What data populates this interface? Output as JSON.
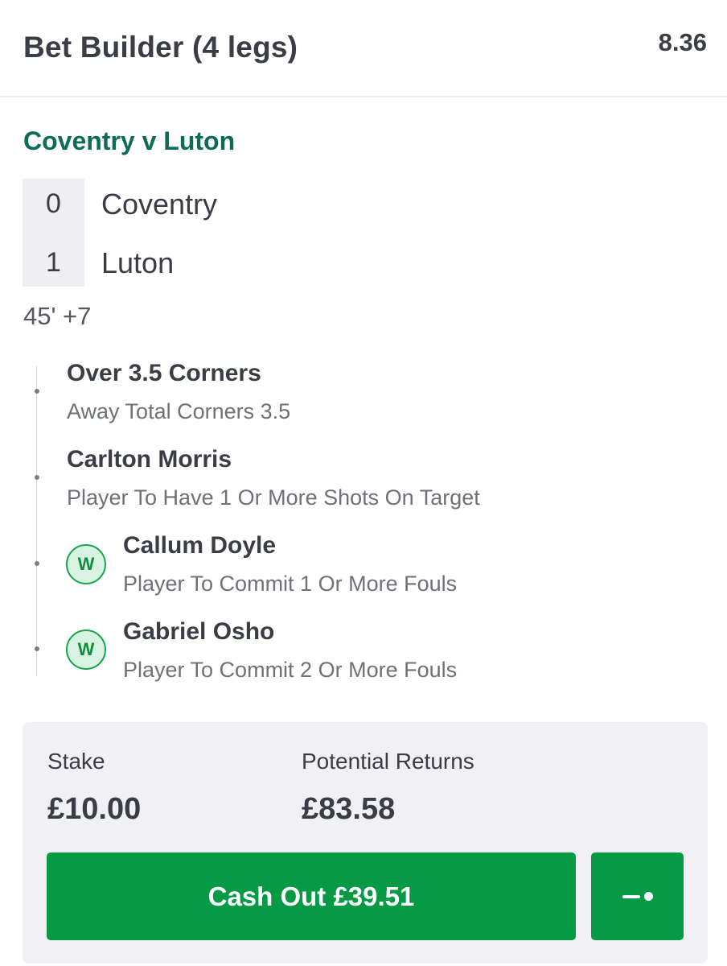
{
  "header": {
    "title": "Bet Builder (4 legs)",
    "odds": "8.36"
  },
  "match": {
    "title": "Coventry v Luton",
    "home_score": "0",
    "home_team": "Coventry",
    "away_score": "1",
    "away_team": "Luton",
    "time": "45' +7"
  },
  "legs": [
    {
      "title": "Over 3.5 Corners",
      "subtitle": "Away Total Corners 3.5",
      "badge": ""
    },
    {
      "title": "Carlton Morris",
      "subtitle": "Player To Have 1 Or More Shots On Target",
      "badge": ""
    },
    {
      "title": "Callum Doyle",
      "subtitle": "Player To Commit 1 Or More Fouls",
      "badge": "W"
    },
    {
      "title": "Gabriel Osho",
      "subtitle": "Player To Commit 2 Or More Fouls",
      "badge": "W"
    }
  ],
  "summary": {
    "stake_label": "Stake",
    "stake_value": "£10.00",
    "returns_label": "Potential Returns",
    "returns_value": "£83.58",
    "cashout_label": "Cash Out £39.51"
  },
  "icons": {
    "win_badge": "win-badge-icon",
    "partial_cashout": "partial-cashout-slider-icon"
  },
  "colors": {
    "brand_green": "#069a45",
    "match_title_green": "#0e6b56",
    "win_badge_bg": "#d9f3e2"
  }
}
